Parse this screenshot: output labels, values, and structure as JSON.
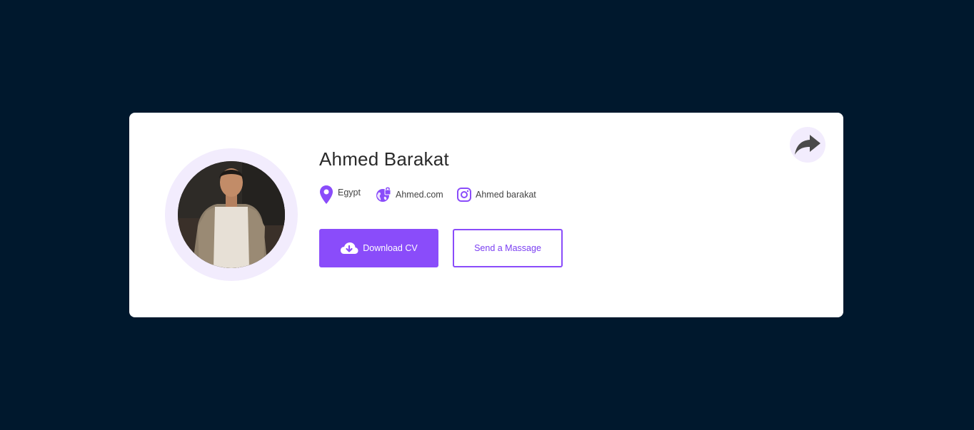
{
  "profile": {
    "name": "Ahmed Barakat",
    "location": "Egypt",
    "website": "Ahmed.com",
    "instagram": "Ahmed barakat"
  },
  "actions": {
    "download_label": "Download CV",
    "message_label": "Send a Massage"
  },
  "icons": {
    "share": "share-arrow-icon",
    "location": "map-pin-icon",
    "website": "globe-lock-icon",
    "instagram": "instagram-icon",
    "download": "cloud-download-icon"
  },
  "colors": {
    "page_background": "#00182d",
    "card_background": "#ffffff",
    "accent": "#8a4cfa",
    "accent_light": "#f2ecfd",
    "text_dark": "#2a2a2a"
  }
}
